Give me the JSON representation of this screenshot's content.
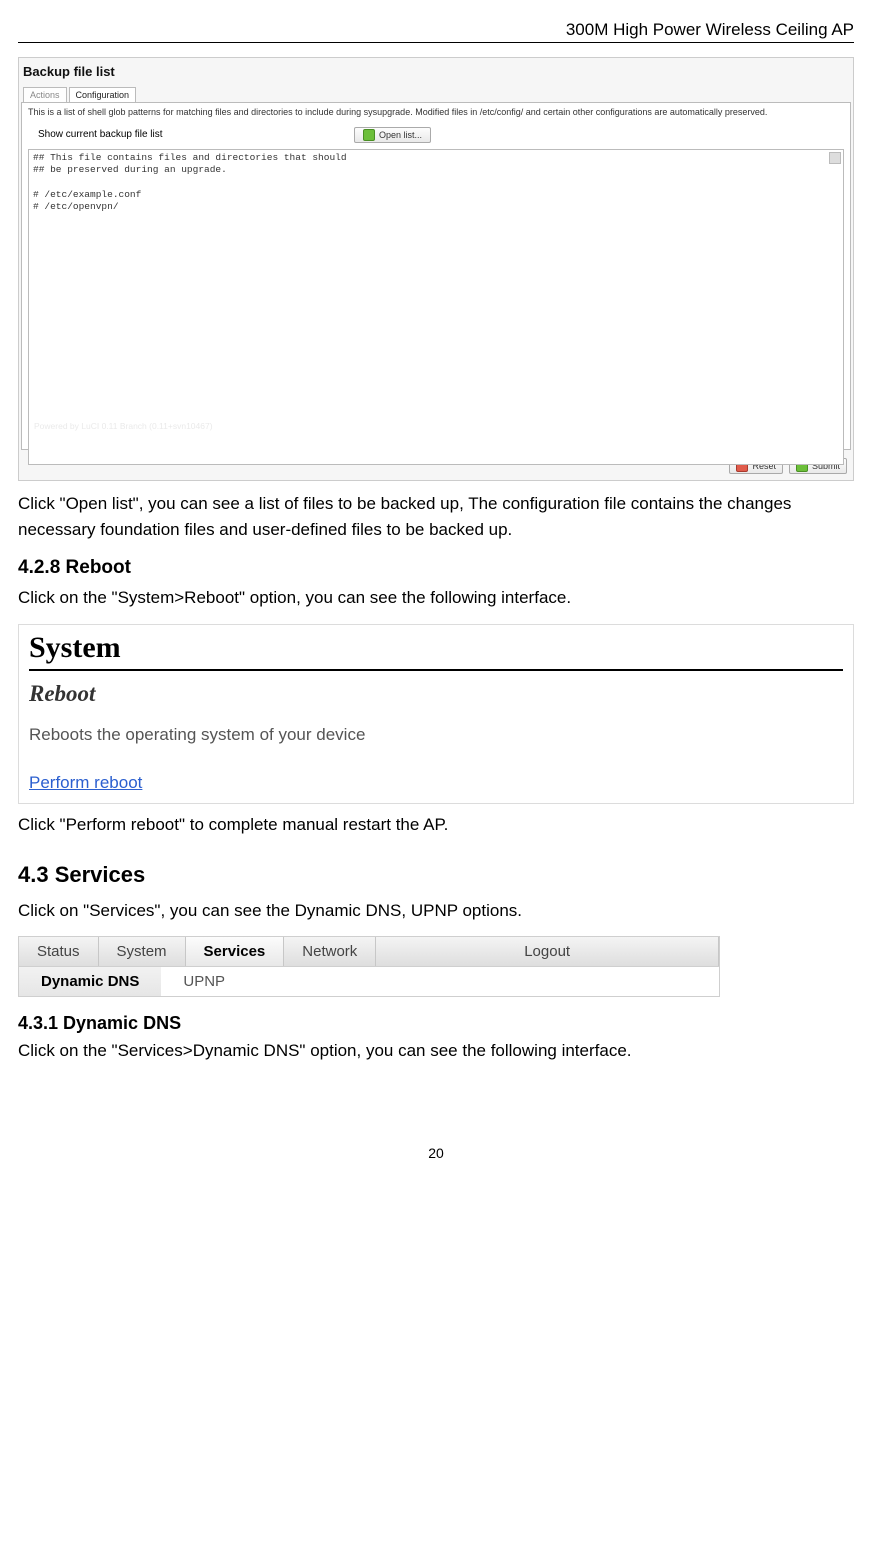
{
  "header": {
    "title": "300M High Power Wireless Ceiling AP"
  },
  "shot1": {
    "panel_title": "Backup file list",
    "tabs": {
      "actions": "Actions",
      "configuration": "Configuration"
    },
    "description": "This is a list of shell glob patterns for matching files and directories to include during sysupgrade. Modified files in /etc/config/ and certain other configurations are automatically preserved.",
    "show_label": "Show current backup file list",
    "open_button": "Open list...",
    "code": "## This file contains files and directories that should\n## be preserved during an upgrade.\n\n# /etc/example.conf\n# /etc/openvpn/",
    "luci_footer": "Powered by LuCI 0.11 Branch (0.11+svn10467)",
    "reset_btn": "Reset",
    "submit_btn": "Submit"
  },
  "para1": "Click \"Open list\", you can see a list of files to be backed up, The configuration file contains the changes necessary foundation files and user-defined files to be backed up.",
  "reboot": {
    "heading": "4.2.8 Reboot",
    "intro": "Click on the \"System>Reboot\" option, you can see the following interface.",
    "shot": {
      "system": "System",
      "reboot": "Reboot",
      "desc": "Reboots the operating system of your device",
      "link": "Perform reboot"
    },
    "after": "Click \"Perform reboot\" to complete manual restart the AP."
  },
  "services": {
    "heading": "4.3 Services",
    "intro": "Click on \"Services\", you can see the Dynamic DNS, UPNP options.",
    "nav": {
      "status": "Status",
      "system": "System",
      "services": "Services",
      "network": "Network",
      "logout": "Logout",
      "ddns": "Dynamic DNS",
      "upnp": "UPNP"
    }
  },
  "ddns": {
    "heading": "4.3.1 Dynamic DNS",
    "intro": "Click on the \"Services>Dynamic DNS\" option, you can see the following interface."
  },
  "page_number": "20"
}
